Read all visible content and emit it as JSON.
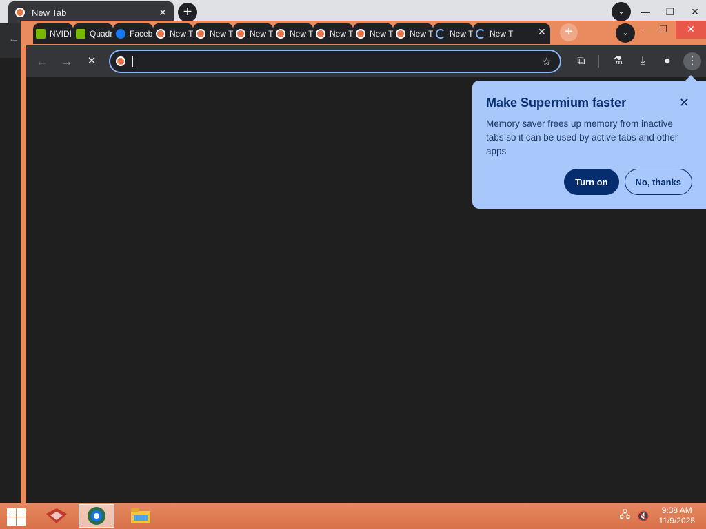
{
  "background_window": {
    "tab_title": "New Tab",
    "new_tab_symbol": "+",
    "close_symbol": "✕",
    "back_symbol": "←"
  },
  "front_window": {
    "tabs": [
      {
        "label": "NVIDI",
        "icon": "nvidia-icon"
      },
      {
        "label": "Quadr",
        "icon": "nvidia-icon"
      },
      {
        "label": "Faceb",
        "icon": "facebook-icon"
      },
      {
        "label": "New T",
        "icon": "supermium-icon"
      },
      {
        "label": "New T",
        "icon": "supermium-icon"
      },
      {
        "label": "New T",
        "icon": "supermium-icon"
      },
      {
        "label": "New T",
        "icon": "supermium-icon"
      },
      {
        "label": "New T",
        "icon": "supermium-icon"
      },
      {
        "label": "New T",
        "icon": "supermium-icon"
      },
      {
        "label": "New T",
        "icon": "supermium-icon"
      },
      {
        "label": "New T",
        "icon": "loading-icon"
      },
      {
        "label": "New T",
        "icon": "loading-icon"
      }
    ],
    "close_symbol": "✕",
    "new_tab_symbol": "+"
  },
  "toolbar": {
    "address_value": "",
    "back_symbol": "←",
    "forward_symbol": "→",
    "stop_symbol": "✕",
    "star_symbol": "☆"
  },
  "popup": {
    "title": "Make Supermium faster",
    "body": "Memory saver frees up memory from inactive tabs so it can be used by active tabs and other apps",
    "primary_button": "Turn on",
    "secondary_button": "No, thanks",
    "close_symbol": "✕"
  },
  "taskbar": {
    "time": "9:38 AM",
    "date": "11/9/2025"
  },
  "colors": {
    "accent": "#e98a5f",
    "popup_bg": "#a8c7fa",
    "popup_button": "#062e6f",
    "content_bg": "#1f1f1f"
  }
}
